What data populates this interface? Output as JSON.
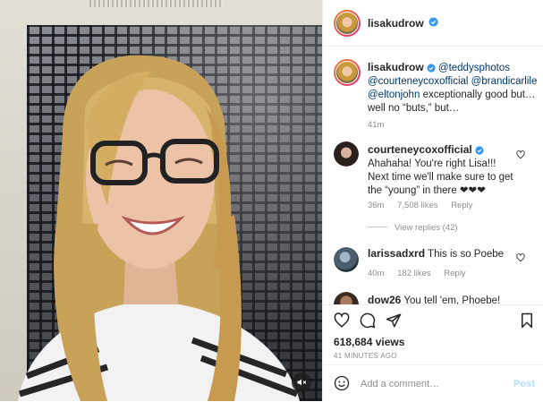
{
  "post": {
    "author": "lisakudrow",
    "caption": {
      "author": "lisakudrow",
      "mentions": [
        "@teddysphotos",
        "@courteneycoxofficial",
        "@brandicarlile",
        "@eltonjohn"
      ],
      "text": "exceptionally good but… well no “buts,” but…",
      "time": "41m"
    },
    "views": "618,684 views",
    "time_ago": "41 MINUTES AGO"
  },
  "comments": [
    {
      "author": "courteneycoxofficial",
      "text": "Ahahaha! You're right Lisa!!! Next time we'll make sure to get the “young” in there ❤❤❤",
      "time": "36m",
      "likes": "7,508 likes",
      "reply": "Reply",
      "view_replies": "View replies (42)"
    },
    {
      "author": "larissadxrd",
      "text": "This is so Poebe ",
      "time": "40m",
      "likes": "182 likes",
      "reply": "Reply"
    },
    {
      "author": "dow26",
      "text": "You tell 'em, Phoebe! "
    }
  ],
  "add_comment": {
    "placeholder": "Add a comment…",
    "post_label": "Post"
  },
  "colors": {
    "verified": "#3897f0",
    "link": "#00376b",
    "muted": "#8e8e8e",
    "post_disabled": "#b2dffc"
  },
  "icons": [
    "verified-badge-icon",
    "heart-icon",
    "comment-icon",
    "share-icon",
    "bookmark-icon",
    "emoji-icon",
    "mute-icon"
  ]
}
